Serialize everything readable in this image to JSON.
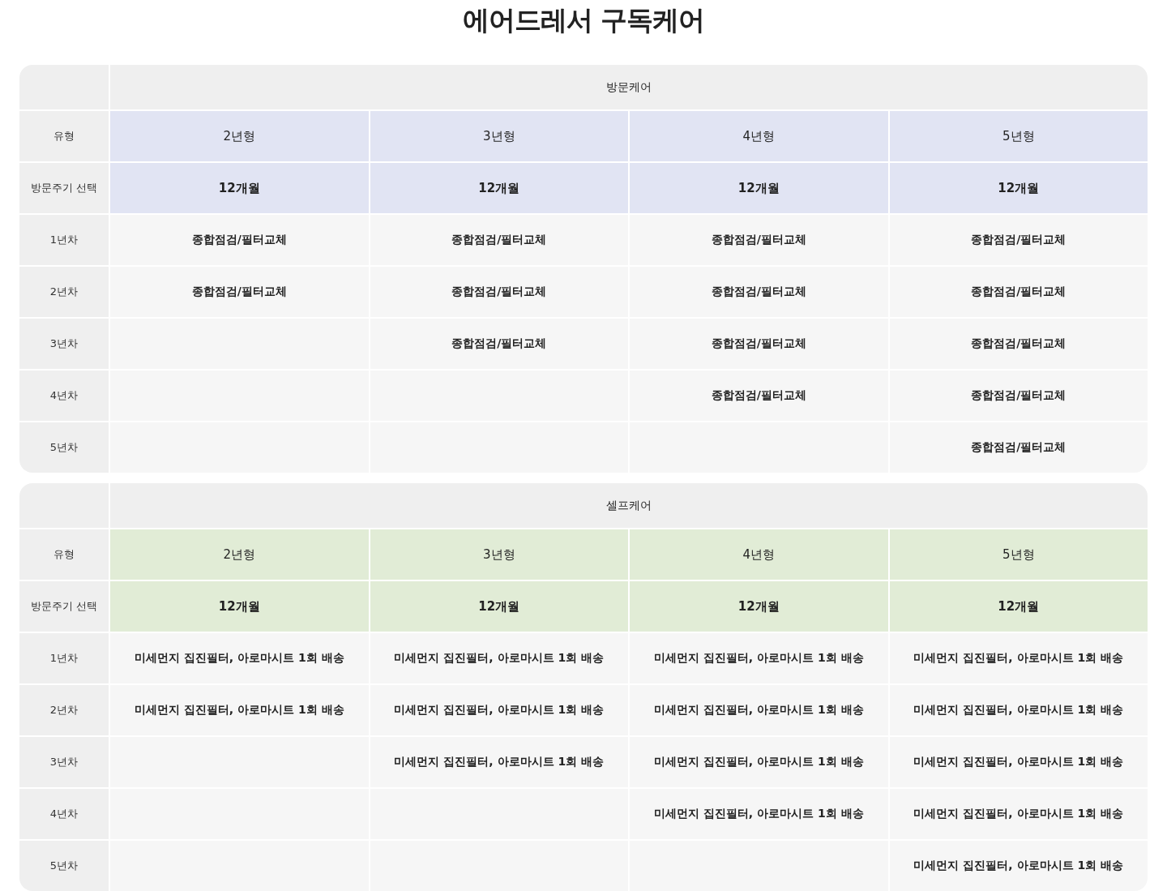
{
  "title": "에어드레서 구독케어",
  "tables": [
    {
      "heading": "방문케어",
      "color": "#e1e4f3",
      "type_label": "유형",
      "types": [
        "2년형",
        "3년형",
        "4년형",
        "5년형"
      ],
      "cycle_label": "방문주기 선택",
      "cycles": [
        "12개월",
        "12개월",
        "12개월",
        "12개월"
      ],
      "rows": [
        {
          "label": "1년차",
          "cells": [
            "종합점검/필터교체",
            "종합점검/필터교체",
            "종합점검/필터교체",
            "종합점검/필터교체"
          ]
        },
        {
          "label": "2년차",
          "cells": [
            "종합점검/필터교체",
            "종합점검/필터교체",
            "종합점검/필터교체",
            "종합점검/필터교체"
          ]
        },
        {
          "label": "3년차",
          "cells": [
            null,
            "종합점검/필터교체",
            "종합점검/필터교체",
            "종합점검/필터교체"
          ]
        },
        {
          "label": "4년차",
          "cells": [
            null,
            null,
            "종합점검/필터교체",
            "종합점검/필터교체"
          ]
        },
        {
          "label": "5년차",
          "cells": [
            null,
            null,
            null,
            "종합점검/필터교체"
          ]
        }
      ]
    },
    {
      "heading": "셀프케어",
      "color": "#e1ecd6",
      "type_label": "유형",
      "types": [
        "2년형",
        "3년형",
        "4년형",
        "5년형"
      ],
      "cycle_label": "방문주기 선택",
      "cycles": [
        "12개월",
        "12개월",
        "12개월",
        "12개월"
      ],
      "rows": [
        {
          "label": "1년차",
          "cells": [
            "미세먼지 집진필터, 아로마시트 1회 배송",
            "미세먼지 집진필터, 아로마시트 1회 배송",
            "미세먼지 집진필터, 아로마시트 1회 배송",
            "미세먼지 집진필터, 아로마시트 1회 배송"
          ]
        },
        {
          "label": "2년차",
          "cells": [
            "미세먼지 집진필터, 아로마시트 1회 배송",
            "미세먼지 집진필터, 아로마시트 1회 배송",
            "미세먼지 집진필터, 아로마시트 1회 배송",
            "미세먼지 집진필터, 아로마시트 1회 배송"
          ]
        },
        {
          "label": "3년차",
          "cells": [
            null,
            "미세먼지 집진필터, 아로마시트 1회 배송",
            "미세먼지 집진필터, 아로마시트 1회 배송",
            "미세먼지 집진필터, 아로마시트 1회 배송"
          ]
        },
        {
          "label": "4년차",
          "cells": [
            null,
            null,
            "미세먼지 집진필터, 아로마시트 1회 배송",
            "미세먼지 집진필터, 아로마시트 1회 배송"
          ]
        },
        {
          "label": "5년차",
          "cells": [
            null,
            null,
            null,
            "미세먼지 집진필터, 아로마시트 1회 배송"
          ]
        }
      ]
    }
  ]
}
